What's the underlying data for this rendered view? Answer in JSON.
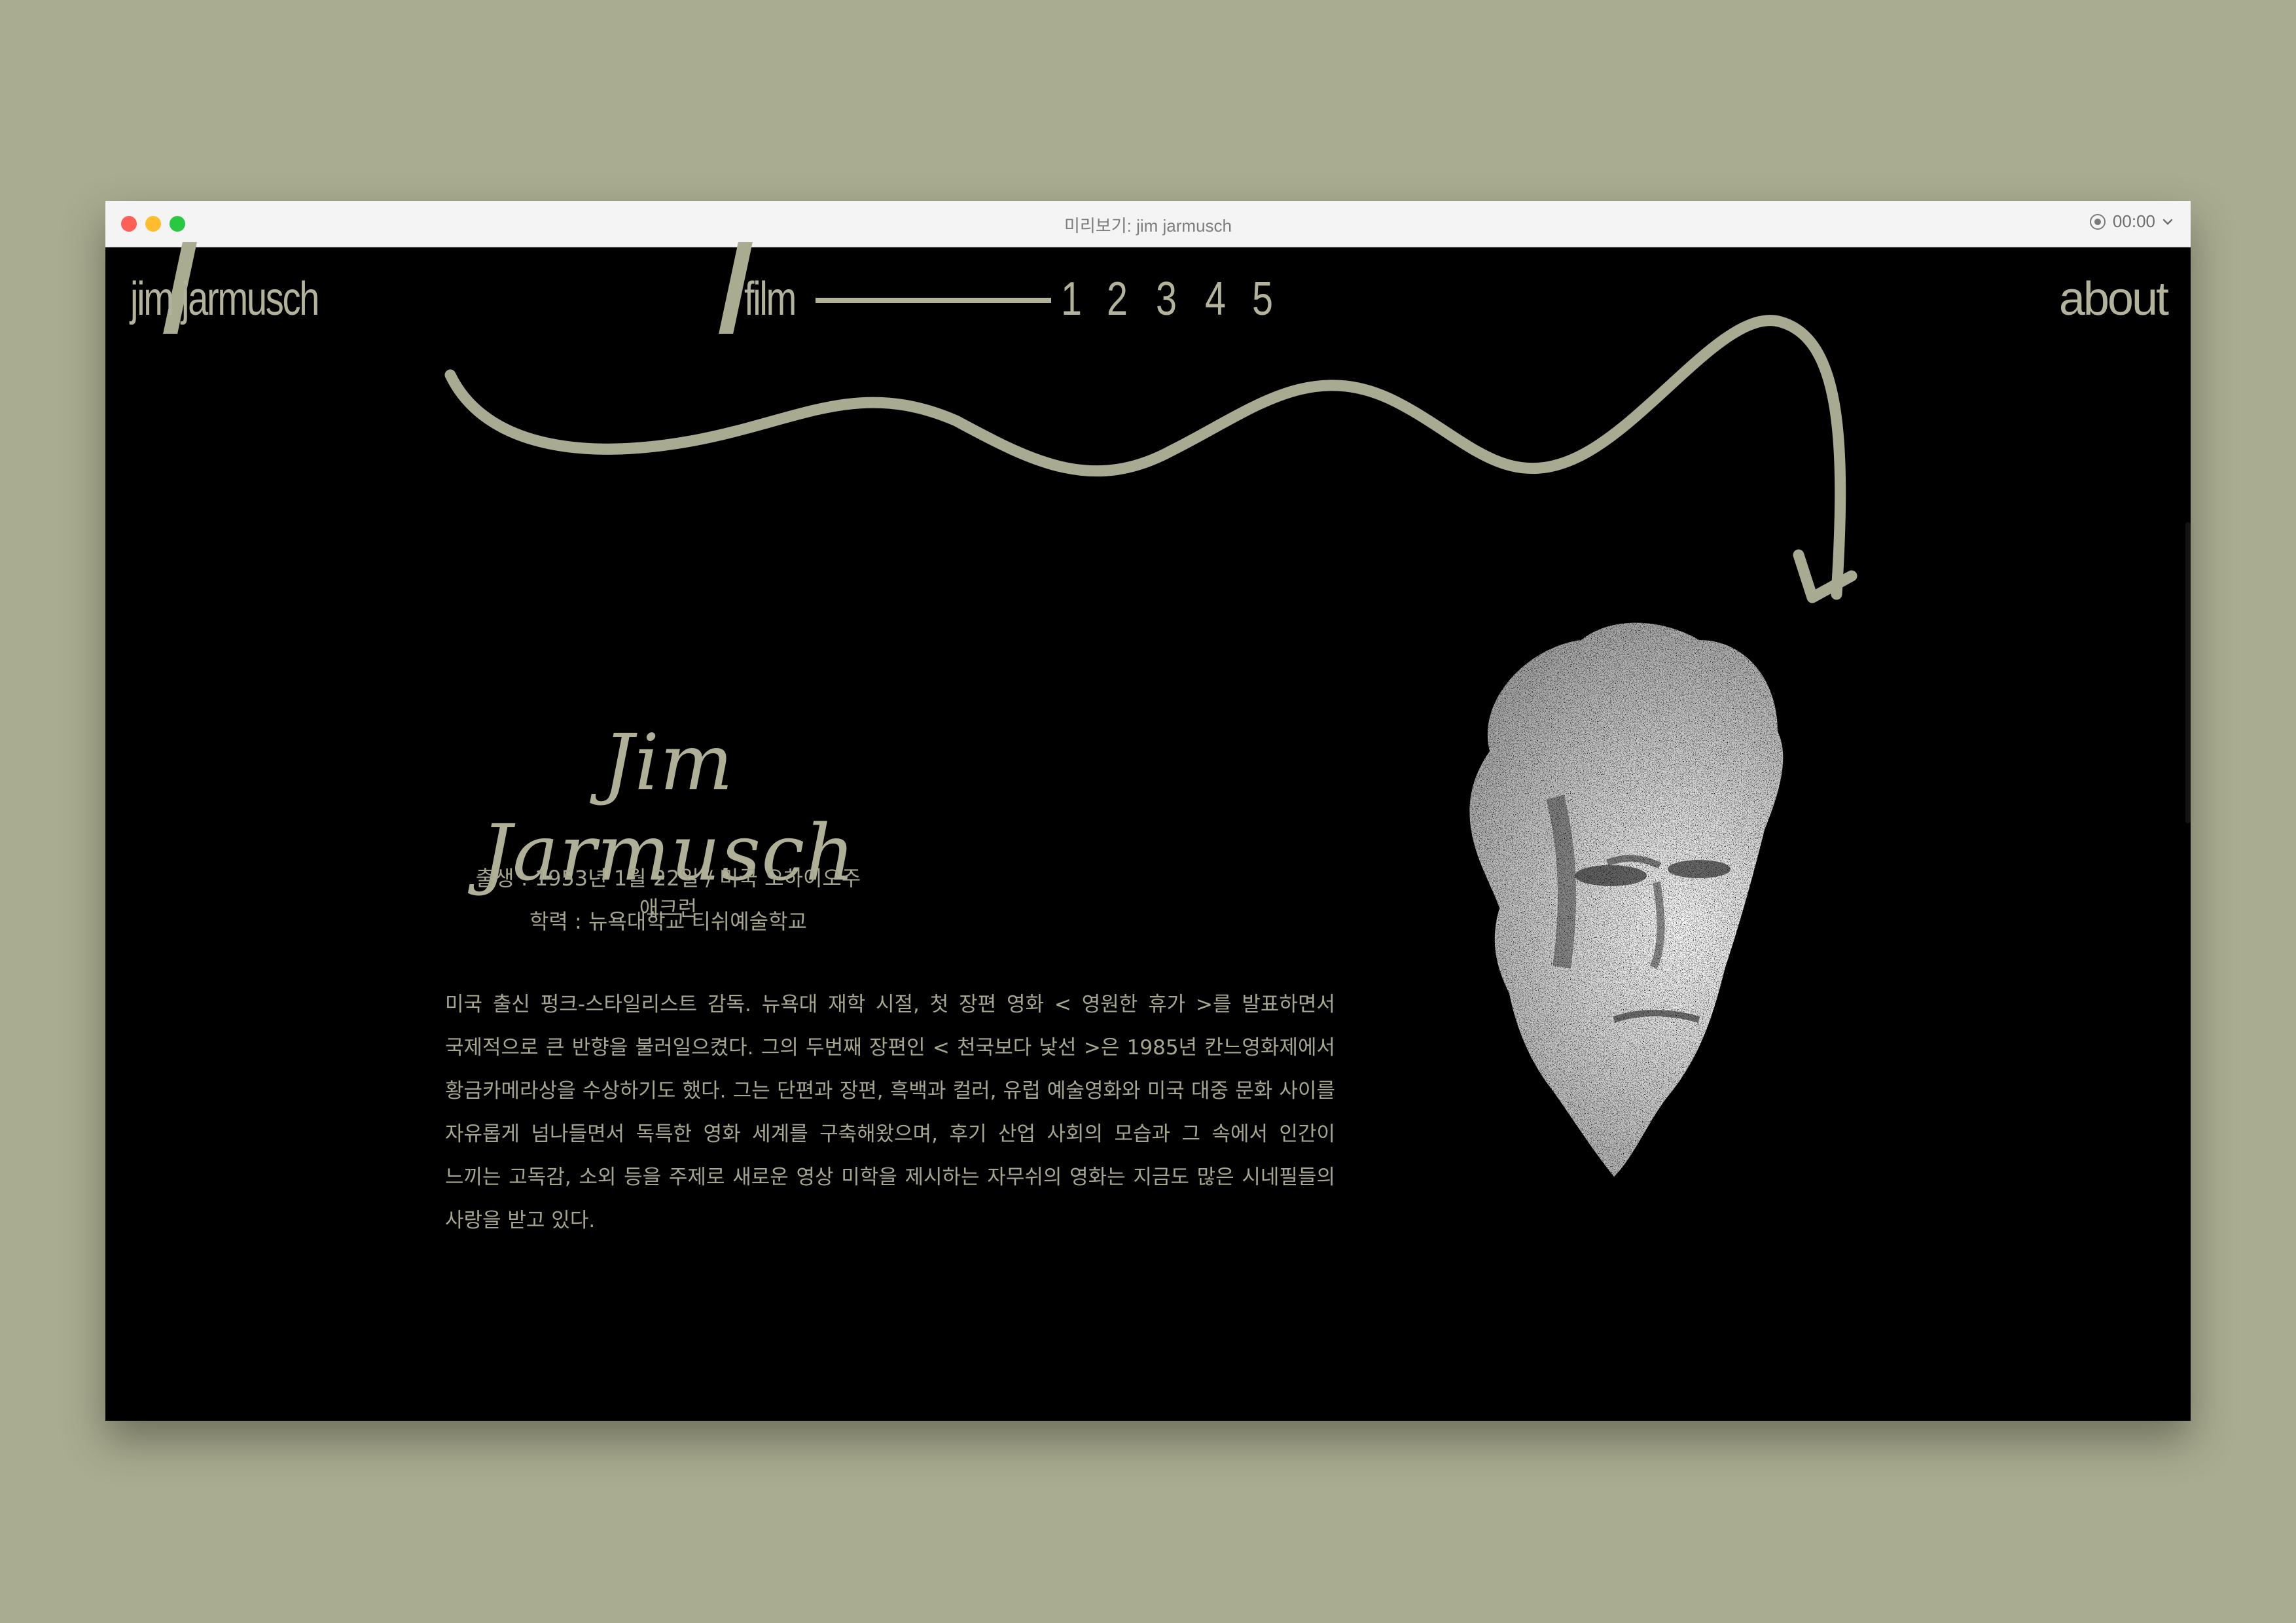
{
  "window": {
    "title": "미리보기: jim jarmusch",
    "timer": "00:00"
  },
  "nav": {
    "logo": "jim jarmusch",
    "film": "film",
    "pages": [
      "1",
      "2",
      "3",
      "4",
      "5"
    ],
    "about": "about"
  },
  "profile": {
    "name": "Jim Jarmusch",
    "birth": "출생 : 1953년 1월 22일 / 미국 오하이오주 애크런",
    "education": "학력 : 뉴욕대학교 티쉬예술학교",
    "bio": "미국 출신 펑크-스타일리스트 감독. 뉴욕대 재학 시절, 첫 장편 영화 < 영원한 휴가 >를 발표하면서 국제적으로 큰 반향을 불러일으켰다. 그의 두번째 장편인 < 천국보다 낯선 >은 1985년 칸느영화제에서 황금카메라상을 수상하기도 했다. 그는 단편과 장편, 흑백과 컬러, 유럽 예술영화와 미국 대중 문화 사이를 자유롭게 넘나들면서 독특한 영화 세계를 구축해왔으며, 후기 산업 사회의 모습과 그 속에서 인간이 느끼는 고독감, 소외 등을 주제로 새로운 영상 미학을 제시하는 자무쉬의 영화는 지금도 많은 시네필들의 사랑을 받고 있다."
  },
  "colors": {
    "background": "#aaac91",
    "accent": "#b3b39c",
    "page": "#000000"
  },
  "icons": {
    "timer": "record-icon",
    "dropdown": "chevron-down-icon",
    "arrow": "squiggle-arrow-icon",
    "portrait": "halftone-portrait"
  }
}
